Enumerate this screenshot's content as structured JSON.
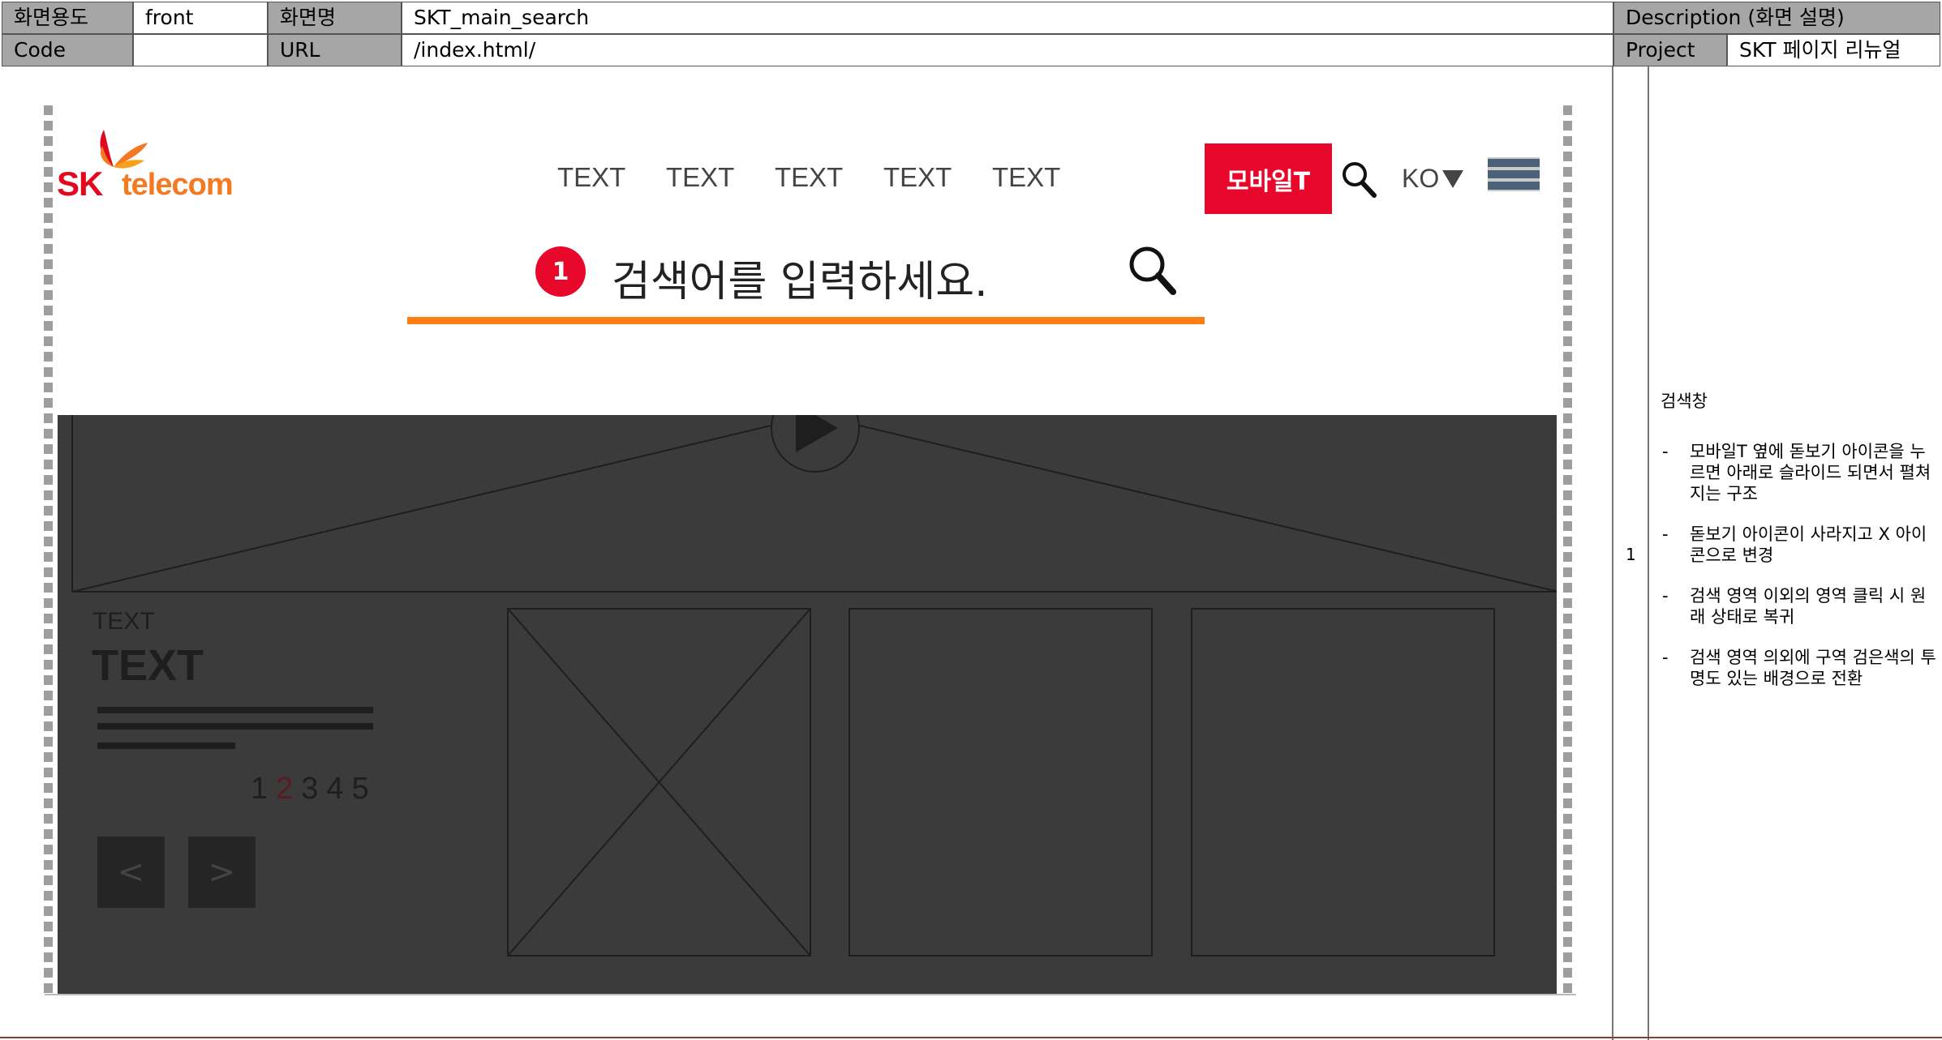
{
  "info": {
    "usage_label": "화면용도",
    "usage_value": "front",
    "screen_name_label": "화면명",
    "screen_name_value": "SKT_main_search",
    "code_label": "Code",
    "code_value": "",
    "url_label": "URL",
    "url_value": "/index.html/",
    "description_label": "Description (화면 설명)",
    "project_label": "Project",
    "project_value": "SKT 페이지 리뉴얼"
  },
  "description": {
    "number": "1",
    "title": "검색창",
    "items": [
      "모바일T 옆에 돋보기 아이콘을 누르면 아래로 슬라이드 되면서 펼쳐지는 구조",
      "돋보기 아이콘이 사라지고 X 아이콘으로 변경",
      "검색 영역 이외의 영역 클릭 시 원래 상태로 복귀",
      "검색 영역 의외에 구역 검은색의 투명도 있는 배경으로 전환"
    ],
    "dash": "-"
  },
  "header": {
    "logo_sk": "SK",
    "logo_telecom": "telecom",
    "nav": [
      "TEXT",
      "TEXT",
      "TEXT",
      "TEXT",
      "TEXT"
    ],
    "mobile_t": "모바일T",
    "lang": "KO",
    "icons": [
      "search-icon",
      "caret-down-icon",
      "hamburger-icon"
    ]
  },
  "search": {
    "badge": "1",
    "placeholder": "검색어를 입력하세요."
  },
  "content": {
    "text_small": "TEXT",
    "text_big": "TEXT",
    "pages": [
      "1",
      "2",
      "3",
      "4",
      "5"
    ],
    "active_page": "2",
    "prev_label": "<",
    "next_label": ">"
  },
  "colors": {
    "brand_red": "#e8082b",
    "search_underline": "#fd7e13",
    "overlay": "#3b3b3b",
    "label_bg": "#a6a6a6"
  }
}
